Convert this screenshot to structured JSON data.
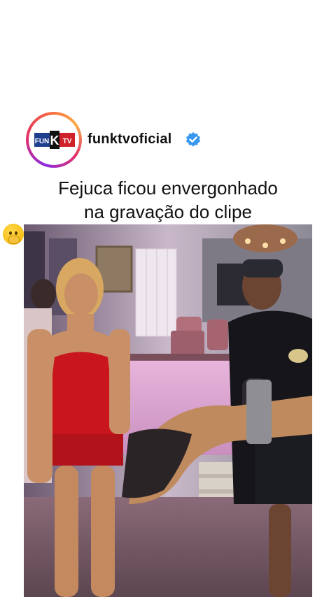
{
  "post": {
    "avatar_logo": {
      "left_text": "FUN",
      "middle_text": "K",
      "right_text": "TV"
    },
    "username": "funktvoficial",
    "verified_icon": "verified-badge-icon",
    "caption_line1": "Fejuca ficou envergonhado",
    "caption_line2": "na gravação do clipe",
    "caption_emoji": "face-with-hand-over-mouth-emoji"
  },
  "colors": {
    "verified_blue": "#3897f0",
    "ring_gradient": [
      "#8a2be2",
      "#e1306c",
      "#f56040",
      "#fcaf45"
    ],
    "logo_red": "#d0202a",
    "logo_blue": "#1e3f8f"
  },
  "video": {
    "scene": "party-room-video-frame"
  }
}
